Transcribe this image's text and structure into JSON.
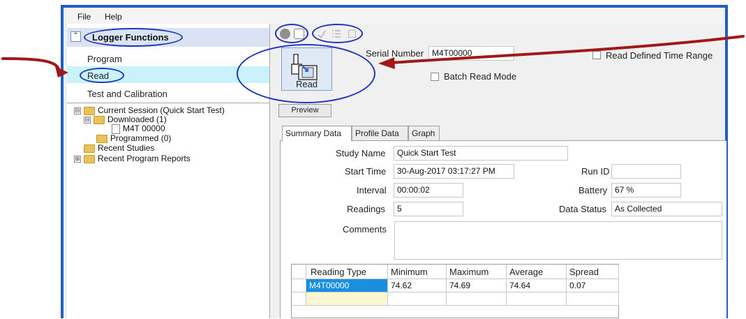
{
  "menu": {
    "file": "File",
    "help": "Help"
  },
  "left_panel": {
    "header_title": "Logger Functions",
    "collapse_glyph": "⌃",
    "nav_items": [
      "Program",
      "Read",
      "Test and Calibration"
    ],
    "tree": [
      {
        "label": "Current Session (Quick Start Test)",
        "toggle": "⊟"
      },
      {
        "label": "Downloaded (1)",
        "toggle": "⊟"
      },
      {
        "label": "M4T 00000"
      },
      {
        "label": "Programmed (0)"
      },
      {
        "label": "Recent Studies"
      },
      {
        "label": "Recent Program Reports",
        "toggle": "⊞"
      }
    ]
  },
  "toolbar": {
    "icons": [
      "print-icon",
      "print-preview-icon",
      "checkmark-icon",
      "list-icon",
      "square-icon"
    ]
  },
  "read_button": {
    "label": "Read",
    "icon": "logger-read-icon"
  },
  "serial_number": {
    "label": "Serial Number",
    "value": "M4T00000"
  },
  "read_defined_time_range": {
    "label": "Read Defined Time Range",
    "checked": false
  },
  "batch_read_mode": {
    "label": "Batch Read Mode",
    "checked": false
  },
  "preview_button": "Preview",
  "tabs": [
    "Summary Data",
    "Profile Data",
    "Graph"
  ],
  "summary": {
    "study_name": {
      "label": "Study Name",
      "value": "Quick Start Test"
    },
    "start_time": {
      "label": "Start Time",
      "value": "30-Aug-2017 03:17:27 PM"
    },
    "interval": {
      "label": "Interval",
      "value": "00:00:02"
    },
    "readings": {
      "label": "Readings",
      "value": "5"
    },
    "comments": {
      "label": "Comments",
      "value": ""
    },
    "run_id": {
      "label": "Run ID",
      "value": ""
    },
    "battery": {
      "label": "Battery",
      "value": "67 %"
    },
    "data_status": {
      "label": "Data Status",
      "value": "As Collected"
    }
  },
  "grid": {
    "headers": [
      "Reading Type",
      "Minimum",
      "Maximum",
      "Average",
      "Spread"
    ],
    "rows": [
      [
        "M4T00000",
        "74.62",
        "74.69",
        "74.64",
        "0.07"
      ],
      [
        "",
        "",
        "",
        "",
        ""
      ]
    ]
  },
  "colors": {
    "window_border": "#1f5fbf",
    "annotation_ellipse": "#2233bb",
    "annotation_arrow": "#a01818",
    "selected_nav_bg": "#c9f2fa",
    "selected_cell_bg": "#1a8fe0",
    "new_row_bg": "#fbf7d0"
  }
}
